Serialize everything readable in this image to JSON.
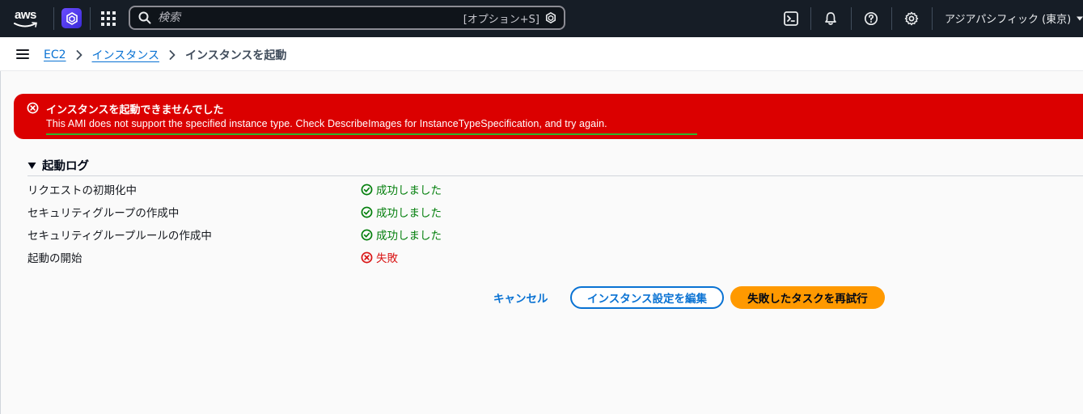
{
  "topnav": {
    "logo_text": "aws",
    "search": {
      "placeholder": "検索",
      "shortcut": "[オプション+S]"
    },
    "region": "アジアパシフィック (東京)"
  },
  "breadcrumb": {
    "items": [
      {
        "label": "EC2"
      },
      {
        "label": "インスタンス"
      },
      {
        "label": "インスタンスを起動"
      }
    ]
  },
  "error": {
    "title": "インスタンスを起動できませんでした",
    "message": "This AMI does not support the specified instance type. Check DescribeImages for InstanceTypeSpecification, and try again."
  },
  "log": {
    "title": "起動ログ",
    "rows": [
      {
        "step": "リクエストの初期化中",
        "status": "成功しました"
      },
      {
        "step": "セキュリティグループの作成中",
        "status": "成功しました"
      },
      {
        "step": "セキュリティグループルールの作成中",
        "status": "成功しました"
      },
      {
        "step": "起動の開始",
        "status": "失敗"
      }
    ]
  },
  "actions": {
    "cancel": "キャンセル",
    "edit": "インスタンス設定を編集",
    "retry": "失敗したタスクを再試行"
  },
  "colors": {
    "nav_bg": "#161d26",
    "error_bg": "#db0000",
    "success": "#037f0c",
    "fail": "#d91515",
    "link": "#0972d3",
    "primary_button": "#ff9900"
  }
}
